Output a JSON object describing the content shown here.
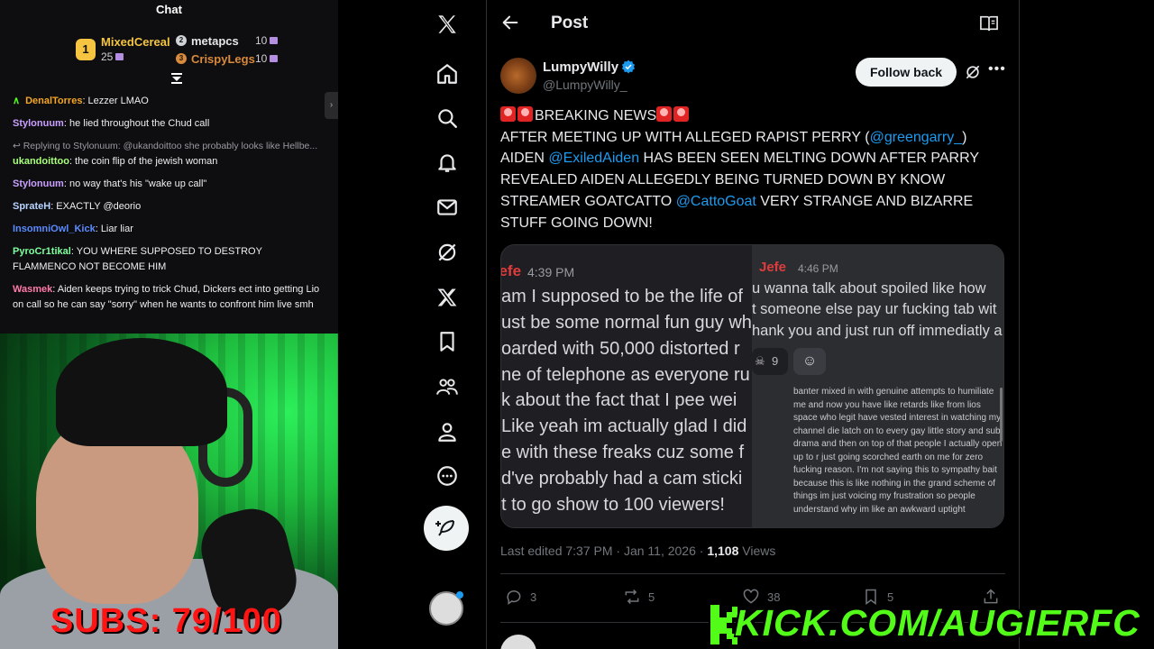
{
  "chat": {
    "title": "Chat",
    "leaderboard": [
      {
        "rank": "1",
        "name": "MixedCereal",
        "count": "25",
        "color": "#f5c542"
      },
      {
        "rank": "2",
        "name": "metapcs",
        "count": "10",
        "color": "#cfd3d8"
      },
      {
        "rank": "3",
        "name": "CrispyLegs",
        "count": "10",
        "color": "#d98a3a"
      }
    ],
    "messages": [
      {
        "user": "DenalTorres",
        "user_color": "#f5a623",
        "text": ": Lezzer LMAO"
      },
      {
        "user": "Stylonuum",
        "user_color": "#c9a0ff",
        "text": ": he lied throughout the Chud call"
      },
      {
        "reply_context": "Replying to Stylonuum: @ukandoittoo she probably looks like Hellbe..."
      },
      {
        "user": "ukandoittoo",
        "user_color": "#a8ff7a",
        "text": ": the coin flip of the jewish woman"
      },
      {
        "user": "Stylonuum",
        "user_color": "#c9a0ff",
        "text": ": no way that's his \"wake up call\""
      },
      {
        "user": "SprateH",
        "user_color": "#b7d3ff",
        "text": ": EXACTLY @deorio"
      },
      {
        "user": "InsomniOwl_Kick",
        "user_color": "#5a8bff",
        "text": ": Liar liar"
      },
      {
        "user": "PyroCr1tikal",
        "user_color": "#7dff9c",
        "text": ": YOU WHERE SUPPOSED TO DESTROY FLAMMENCO NOT BECOME HIM"
      },
      {
        "user": "Wasmek",
        "user_color": "#ff7aa8",
        "text": ": Aiden keeps trying to trick Chud, Dickers ect into getting Lio on call so he can say \"sorry\" when he wants to confront him live smh"
      }
    ]
  },
  "overlay": {
    "subs": "SUBS: 79/100",
    "kick": "KICK.COM/AUGIERFC"
  },
  "x": {
    "nav_icons": [
      "x-logo-icon",
      "home-icon",
      "search-icon",
      "notifications-icon",
      "messages-icon",
      "grok-icon",
      "premium-icon",
      "bookmarks-icon",
      "communities-icon",
      "profile-icon",
      "more-icon"
    ],
    "header_title": "Post",
    "author": {
      "name": "LumpyWilly",
      "handle": "@LumpyWilly_"
    },
    "follow_label": "Follow back",
    "tweet": {
      "headline": "BREAKING NEWS",
      "l1a": "AFTER MEETING UP WITH ALLEGED RAPIST PERRY (",
      "m1": "@greengarry_",
      "l1b": ")",
      "l2a": "AIDEN ",
      "m2": "@ExiledAiden",
      "l2b": " HAS BEEN SEEN MELTING DOWN AFTER PARRY REVEALED AIDEN ALLEGEDLY BEING TURNED DOWN BY KNOW STREAMER GOATCATTO ",
      "m3": "@CattoGoat",
      "l2c": " VERY STRANGE AND BIZARRE STUFF GOING DOWN!"
    },
    "media": {
      "left": {
        "name": "Jefe",
        "time": "4:39 PM",
        "lines": [
          "am I supposed to be the life of",
          "ust be some normal fun guy wh",
          "oarded with 50,000 distorted r",
          "ne of telephone as everyone ru",
          "k about the fact that I pee wei",
          "Like yeah im actually glad I did",
          "e with these freaks cuz some f",
          "d've probably had a cam sticki",
          "t to go show to 100 viewers!"
        ]
      },
      "right": {
        "name": "Jefe",
        "time": "4:46 PM",
        "lines": [
          "u wanna talk about spoiled like how",
          "t someone else pay ur fucking tab wit",
          "hank you and just run off immediatly a"
        ],
        "reaction_count": "9",
        "paragraph": "banter mixed in with genuine attempts to humiliate me and now you have like retards like from lios space who legit have vested interest in watching my channel die latch on to every gay little story and sub drama and then on top of that people I actually open up to r just going scorched earth on me for zero fucking reason. I'm not saying this to sympathy bait because this is like nothing in the grand scheme of things im just voicing my frustration so people understand why im like an awkward uptight"
      }
    },
    "meta": {
      "edited": "Last edited 7:37 PM · Jan 11, 2026 · ",
      "views_count": "1,108",
      "views_label": " Views"
    },
    "actions": {
      "replies": "3",
      "reposts": "5",
      "likes": "38",
      "bookmarks": "5"
    },
    "colors": {
      "accent": "#1d9bf0",
      "text": "#e7e9ea",
      "muted": "#71767b"
    }
  }
}
